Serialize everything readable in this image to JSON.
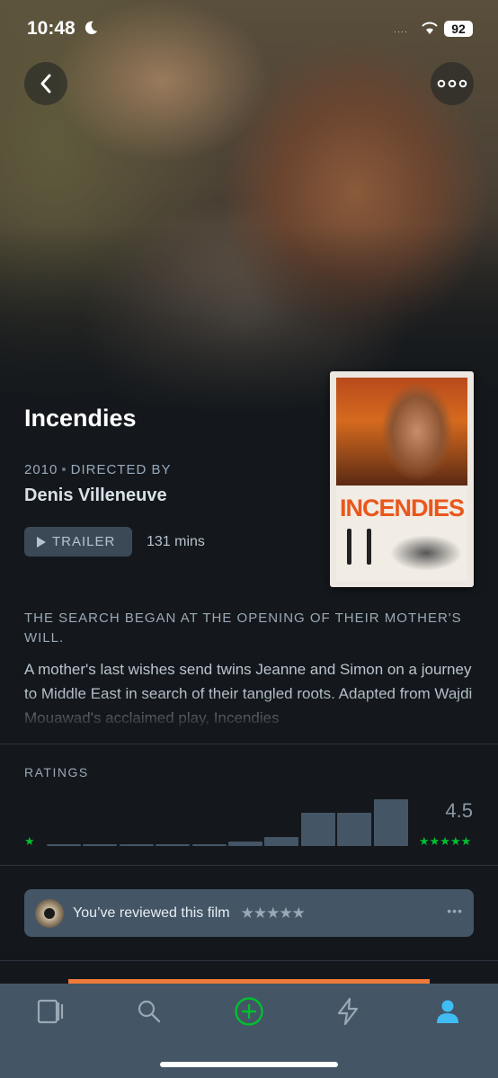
{
  "status_bar": {
    "time": "10:48",
    "signal": "····",
    "battery": "92"
  },
  "film": {
    "title": "Incendies",
    "year": "2010",
    "directed_by_label": "DIRECTED BY",
    "director": "Denis Villeneuve",
    "trailer_label": "TRAILER",
    "runtime": "131 mins",
    "poster_title": "INCENDIES",
    "tagline": "THE SEARCH BEGAN AT THE OPENING OF THEIR MOTHER'S WILL.",
    "synopsis": "A mother's last wishes send twins Jeanne and Simon on a journey to Middle East in search of their tangled roots. Adapted from Wajdi Mouawad's acclaimed play, Incendies"
  },
  "ratings": {
    "label": "RATINGS",
    "low_star": "★",
    "average": "4.5",
    "high_stars": "★★★★★",
    "histogram": [
      0.02,
      0.02,
      0.02,
      0.02,
      0.02,
      0.08,
      0.16,
      0.6,
      0.6,
      0.86
    ]
  },
  "review": {
    "text": "You’ve reviewed this film",
    "stars": "★★★★★",
    "more": "•••"
  },
  "tabs": [
    {
      "name": "films",
      "icon": "film-icon",
      "active": false
    },
    {
      "name": "search",
      "icon": "search-icon",
      "active": false
    },
    {
      "name": "add",
      "icon": "plus-circle-icon",
      "active": false
    },
    {
      "name": "activity",
      "icon": "lightning-icon",
      "active": false
    },
    {
      "name": "profile",
      "icon": "person-icon",
      "active": true
    }
  ],
  "colors": {
    "background": "#14181c",
    "accent_green": "#00c030",
    "active_blue": "#40bcf4",
    "tabbar": "#445566"
  }
}
